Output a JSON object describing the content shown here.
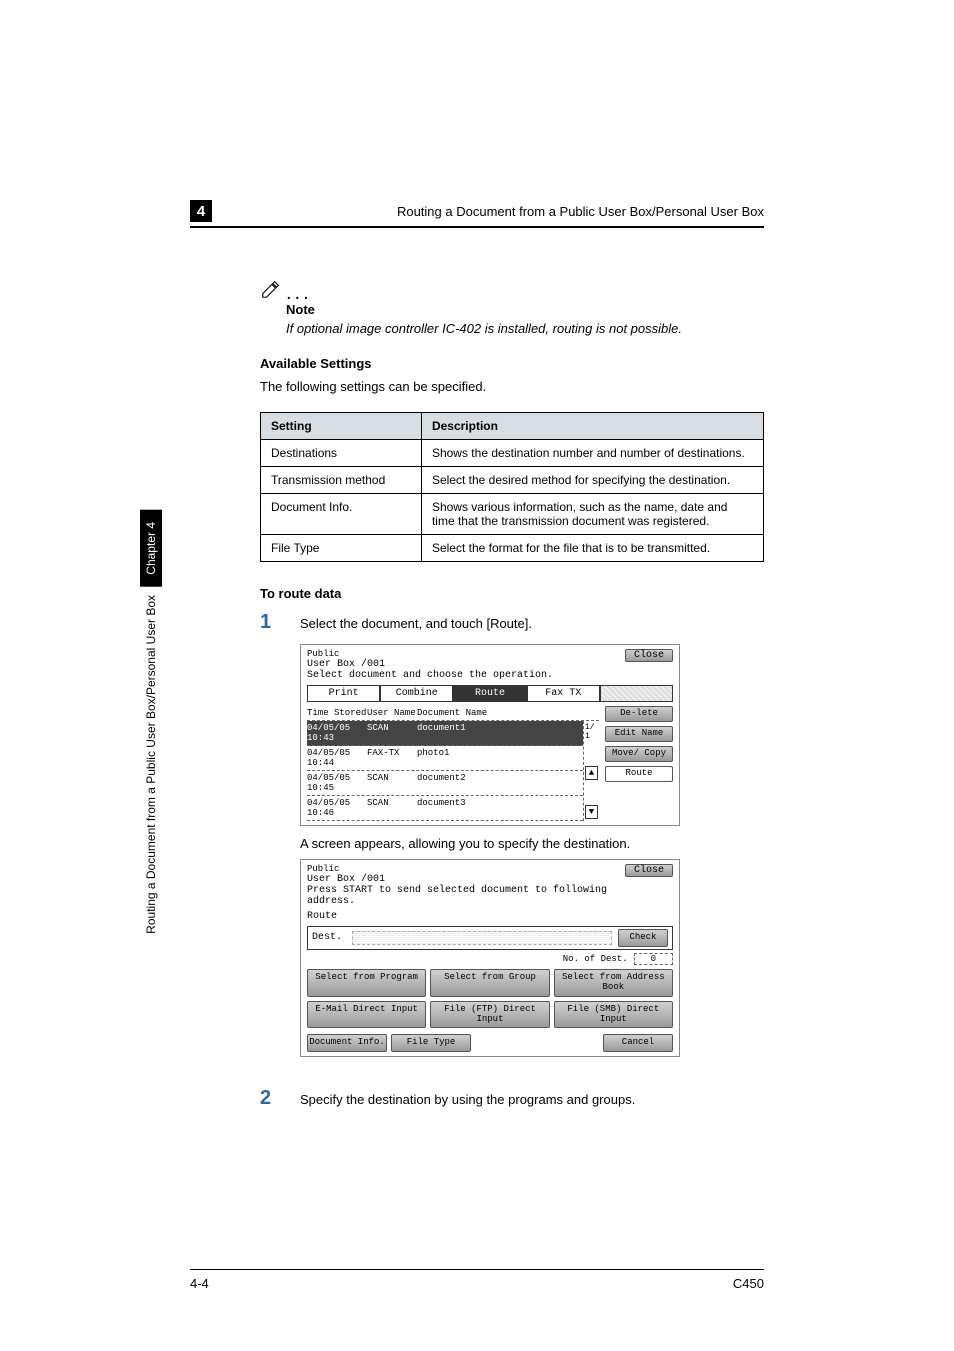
{
  "header": {
    "chapter_num": "4",
    "running_title": "Routing a Document from a Public User Box/Personal User Box"
  },
  "note": {
    "label": "Note",
    "text": "If optional image controller IC-402 is installed, routing is not possible."
  },
  "section_available": {
    "heading": "Available Settings",
    "intro": "The following settings can be specified."
  },
  "table": {
    "col1": "Setting",
    "col2": "Description",
    "rows": [
      {
        "s": "Destinations",
        "d": "Shows the destination number and number of destinations."
      },
      {
        "s": "Transmission method",
        "d": "Select the desired method for specifying the destination."
      },
      {
        "s": "Document Info.",
        "d": "Shows various information, such as the name, date and time that the transmission document was registered."
      },
      {
        "s": "File Type",
        "d": "Select the format for the file that is to be transmitted."
      }
    ]
  },
  "section_route": {
    "heading": "To route data"
  },
  "steps": {
    "1": {
      "num": "1",
      "text": "Select the document, and touch [Route]."
    },
    "after1": "A screen appears, allowing you to specify the destination.",
    "2": {
      "num": "2",
      "text": "Specify the destination by using the programs and groups."
    }
  },
  "lcd1": {
    "title_line1": "Public",
    "title_line2": "User Box  /001",
    "subtext": "Select document and choose the operation.",
    "close": "Close",
    "tabs": {
      "print": "Print",
      "combine": "Combine",
      "route": "Route",
      "fax": "Fax TX"
    },
    "header": {
      "time": "Time Stored",
      "user": "User Name",
      "doc": "Document Name"
    },
    "rows": [
      {
        "t": "04/05/05 10:43",
        "u": "SCAN",
        "d": "document1",
        "sel": true
      },
      {
        "t": "04/05/05 10:44",
        "u": "FAX-TX",
        "d": "photo1",
        "sel": false
      },
      {
        "t": "04/05/05 10:45",
        "u": "SCAN",
        "d": "document2",
        "sel": false
      },
      {
        "t": "04/05/05 10:46",
        "u": "SCAN",
        "d": "document3",
        "sel": false
      }
    ],
    "page_indicator": "1/ 1",
    "side": {
      "delete": "De-lete",
      "edit": "Edit Name",
      "move": "Move/ Copy",
      "route": "Route"
    }
  },
  "lcd2": {
    "title_line1": "Public",
    "title_line2": "User Box  /001",
    "subtext": "Press START to send selected document to following address.",
    "close": "Close",
    "route_label": "Route",
    "dest_label": "Dest.",
    "check": "Check",
    "numdest_label": "No. of Dest.",
    "numdest_value": "0",
    "row1": {
      "a": "Select from Program",
      "b": "Select from Group",
      "c": "Select from Address Book"
    },
    "row2": {
      "a": "E-Mail Direct Input",
      "b": "File (FTP) Direct Input",
      "c": "File (SMB) Direct Input"
    },
    "bottom": {
      "docinfo": "Document Info.",
      "filetype": "File Type",
      "cancel": "Cancel"
    }
  },
  "sidebar": {
    "chapter": "Chapter 4",
    "title": "Routing a Document from a Public User Box/Personal User Box"
  },
  "footer": {
    "left": "4-4",
    "right": "C450"
  }
}
